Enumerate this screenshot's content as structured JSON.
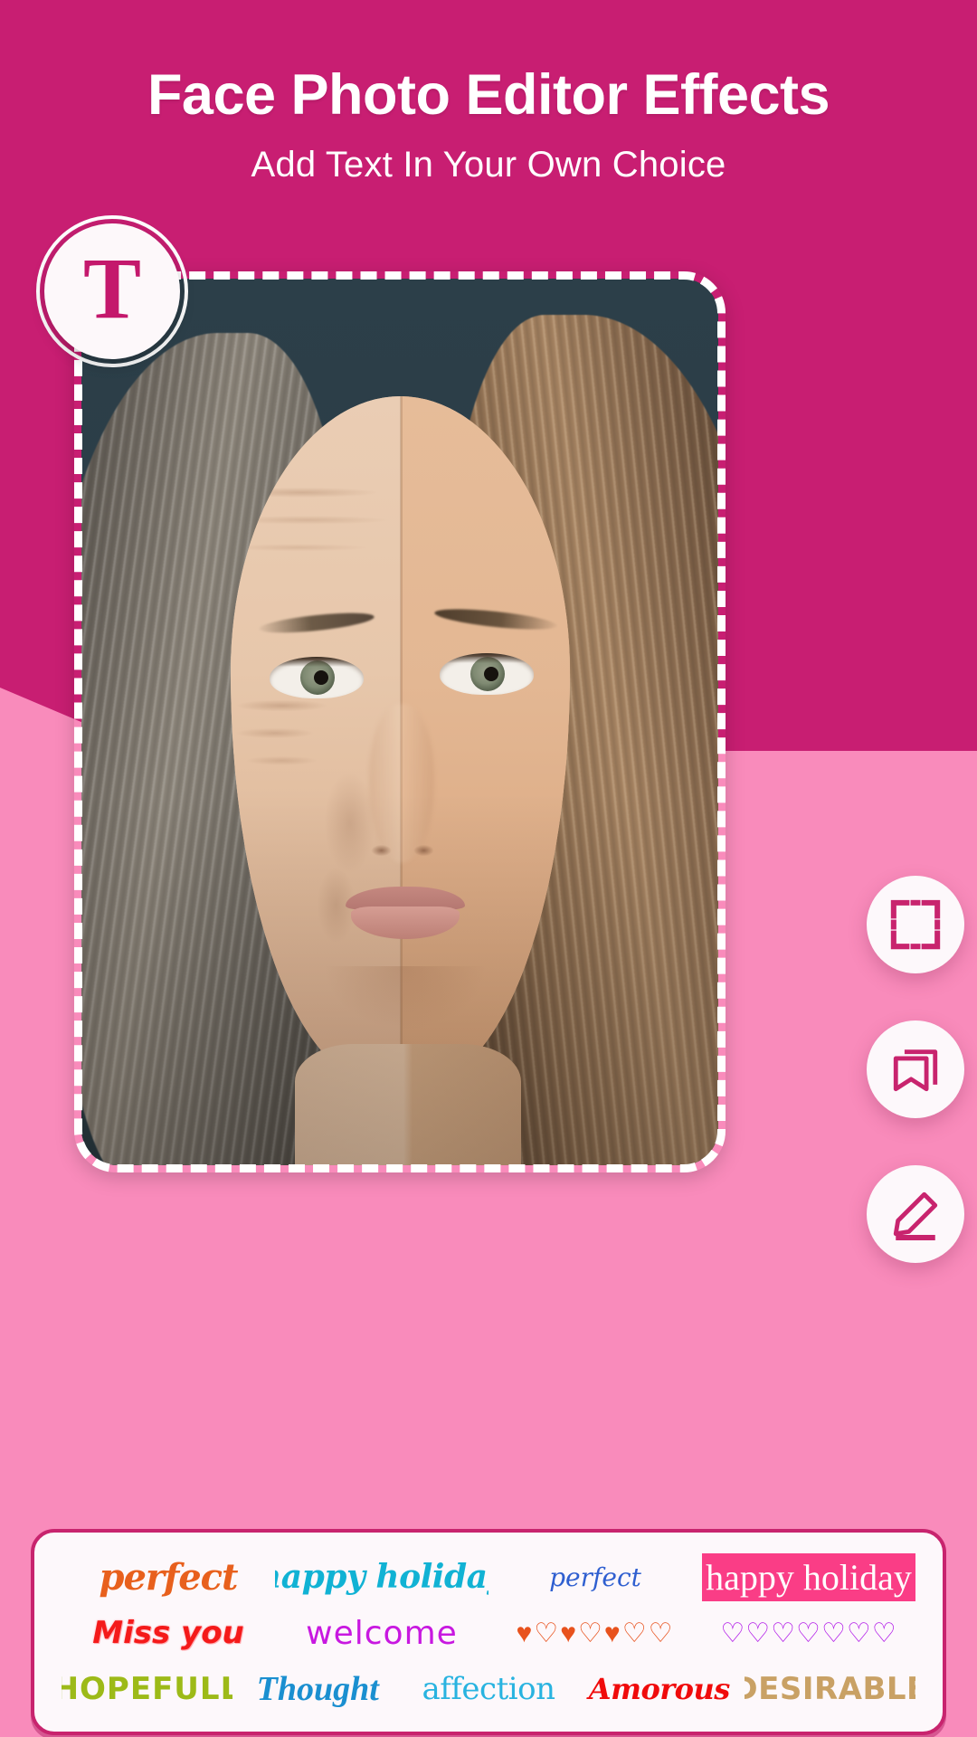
{
  "header": {
    "title": "Face Photo Editor Effects",
    "subtitle": "Add Text In Your Own Choice"
  },
  "colors": {
    "hero_bg": "#c81e72",
    "page_bg": "#f98bbb",
    "accent": "#c4186c",
    "panel_bg": "#fdf8fb",
    "panel_border": "#c8246e",
    "photo_bg": "#2b3e48"
  },
  "add_text_button": {
    "label": "T",
    "icon": "text-tool-icon"
  },
  "tools": [
    {
      "name": "crop-tool",
      "icon": "crop-icon"
    },
    {
      "name": "sticker-tool",
      "icon": "bookmark-sticker-icon"
    },
    {
      "name": "edit-tool",
      "icon": "pencil-edit-icon"
    }
  ],
  "photo": {
    "alt": "Half-aged half-young portrait of a woman",
    "selection_border": "dashed-white"
  },
  "presets": {
    "rows": [
      [
        {
          "text": "perfect",
          "style": "ps-perfect-orange",
          "color": "#e8601d"
        },
        {
          "text": "happy holiday",
          "style": "ps-happy-cyan",
          "color": "#11b2d4"
        },
        {
          "text": "perfect",
          "style": "ps-perfect-blue",
          "color": "#2f5fd0"
        },
        {
          "text": "happy holiday",
          "style": "ps-happy-hl",
          "color": "#ffffff"
        }
      ],
      [
        {
          "text": "Miss you",
          "style": "ps-missyou",
          "color": "#f41a1a"
        },
        {
          "text": "welcome",
          "style": "ps-welcome-mag",
          "color": "#c818e0"
        },
        {
          "text": "♥♡♥♡♥♡♡",
          "style": "ps-hearts",
          "color": "#e8521d"
        },
        {
          "text": "♡♡♡♡♡♡♡",
          "style": "ps-welcome-hearts",
          "color": "#b119e8"
        }
      ],
      [
        {
          "text": "HOPEFULL",
          "style": "ps-hopefull",
          "color": "#9dba18"
        },
        {
          "text": "Thought",
          "style": "ps-thought",
          "color": "#1a8fd0"
        },
        {
          "text": "affection",
          "style": "ps-affection",
          "color": "#28b3e0"
        },
        {
          "text": "Amorous",
          "style": "ps-amorous",
          "color": "#f00b0b"
        },
        {
          "text": "DESIRABLE",
          "style": "ps-desirable",
          "color": "#c9a165"
        }
      ]
    ]
  }
}
